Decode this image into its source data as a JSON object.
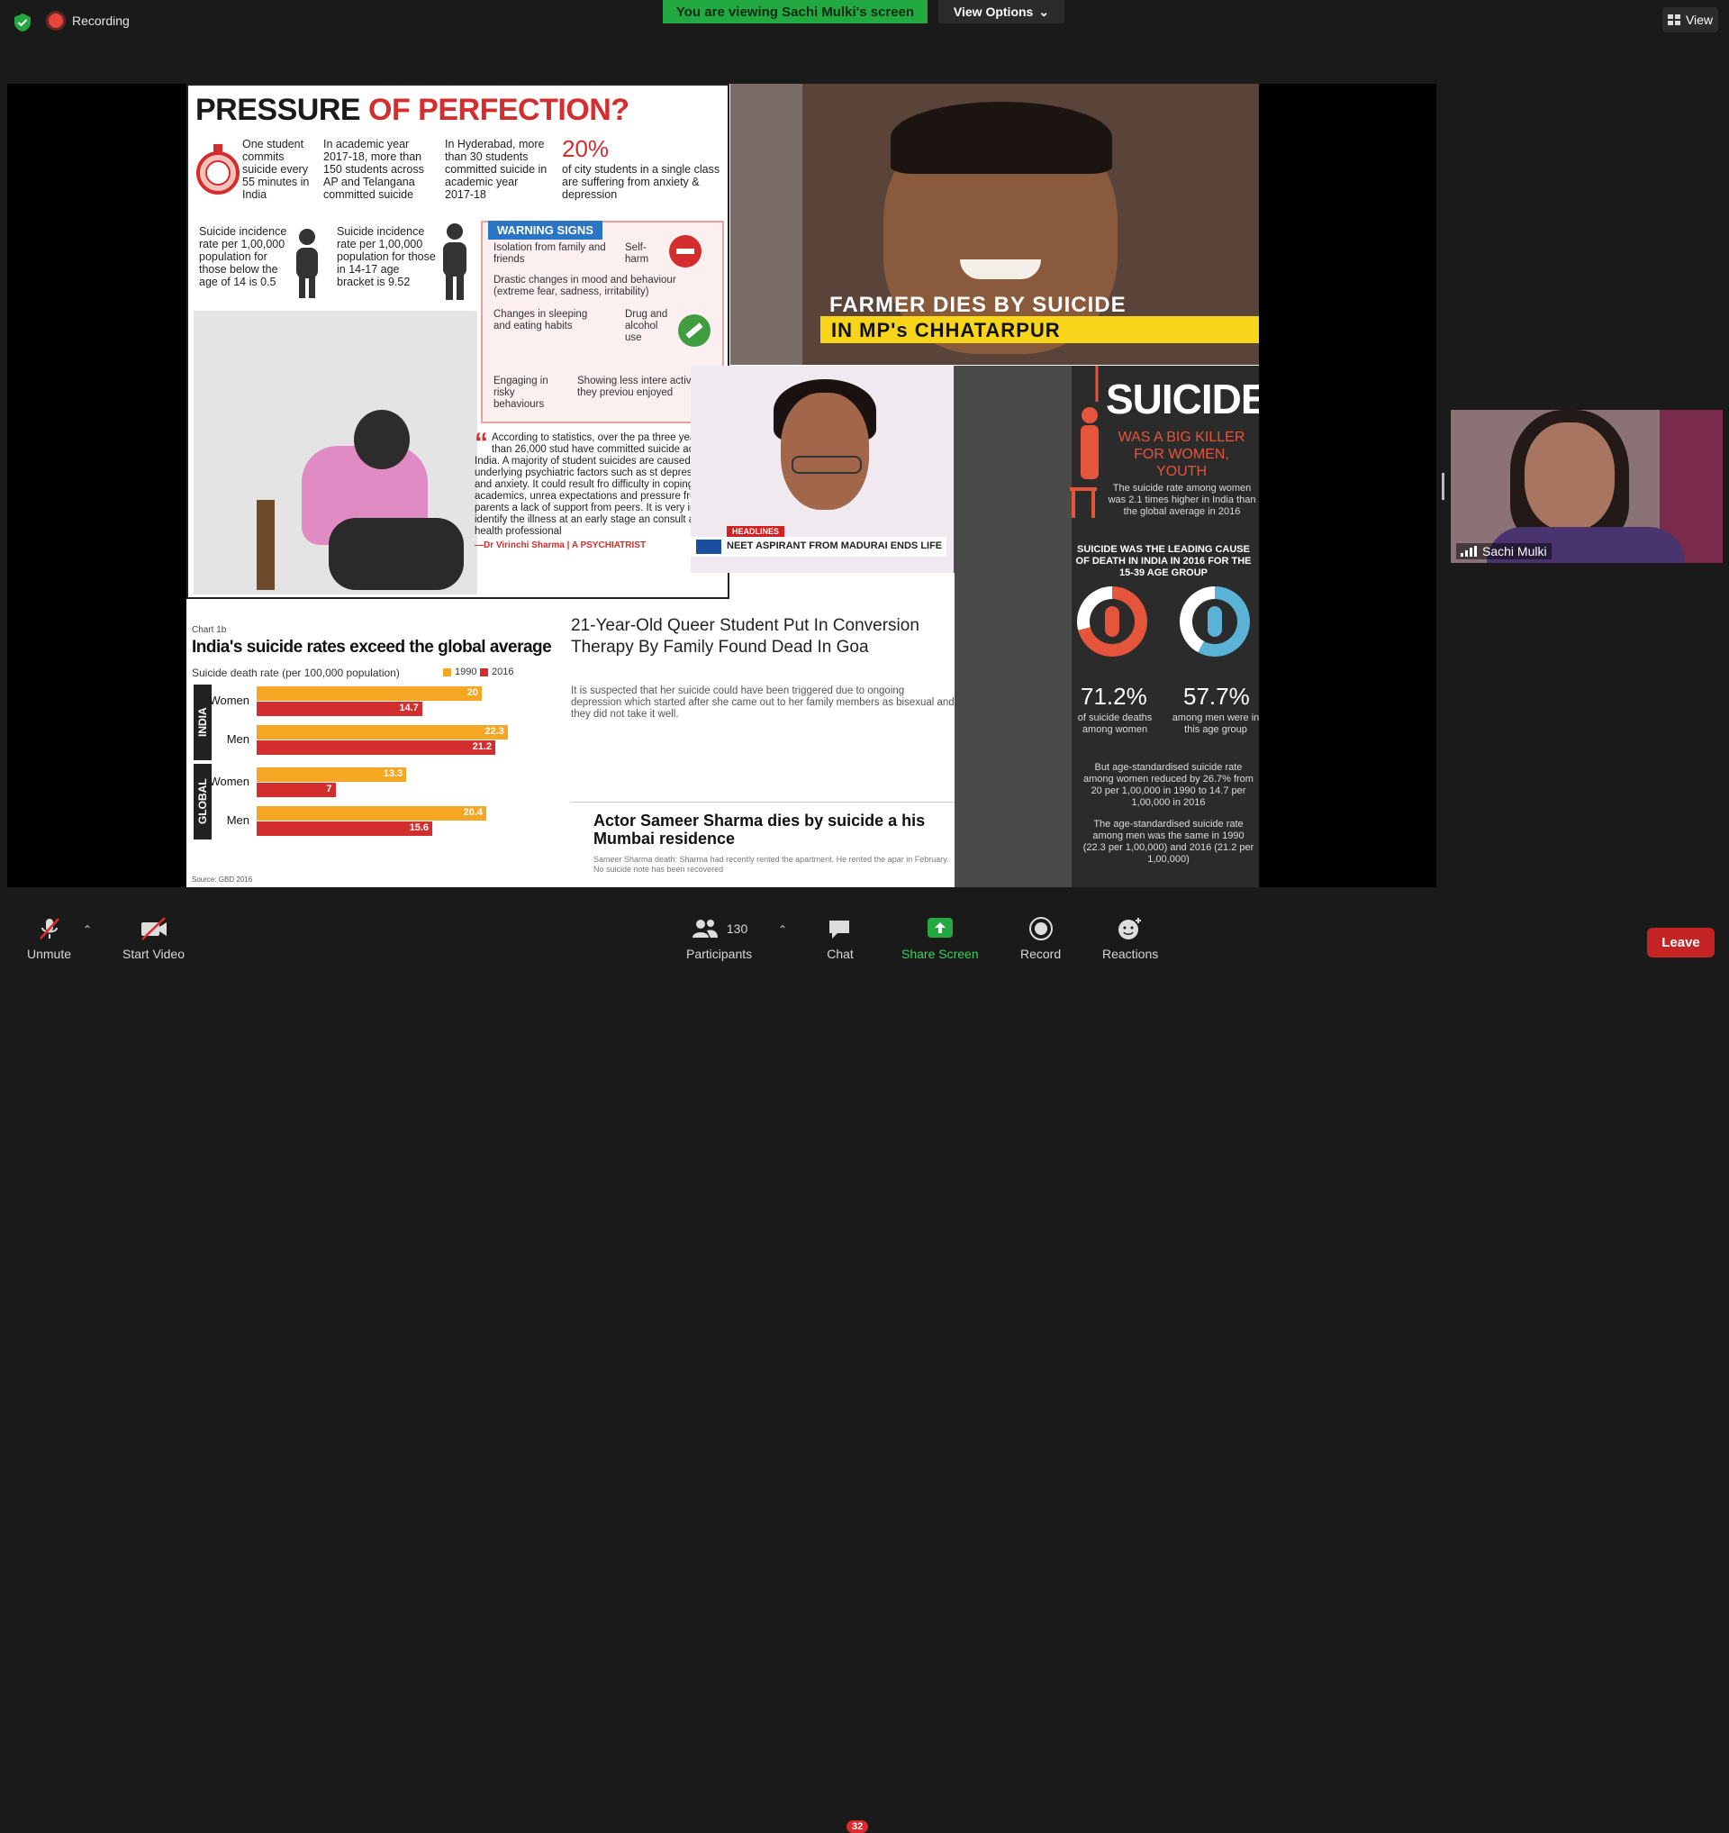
{
  "topbar": {
    "recording_label": "Recording",
    "viewing_banner": "You are viewing Sachi Mulki's screen",
    "view_options_label": "View Options",
    "view_label": "View"
  },
  "slide": {
    "pressure": {
      "title_a": "PRESSURE",
      "title_b": "OF PERFECTION?",
      "stat1": "One student commits suicide every 55 minutes in India",
      "stat2": "In academic year 2017-18, more than 150 students across AP and Telangana committed suicide",
      "stat3": "In Hyderabad, more than 30 students committed suicide in academic year 2017-18",
      "stat4_pct": "20%",
      "stat4": "of city students in a single class are suffering from anxiety & depression",
      "stat5": "Suicide incidence rate per 1,00,000 population for those below the age of 14 is 0.5",
      "stat6": "Suicide incidence rate per 1,00,000 population for those in 14-17 age bracket is 9.52",
      "warning_header": "WARNING SIGNS",
      "warn1": "Isolation from family and friends",
      "warn2": "Self-harm",
      "warn3": "Drastic changes in mood and behaviour (extreme fear, sadness, irritability)",
      "warn4": "Changes in sleeping and eating habits",
      "warn5": "Drug and alcohol use",
      "warn6": "Engaging in risky behaviours",
      "warn7": "Showing less intere activities they previou enjoyed",
      "quote": "According to statistics, over the pa three years more than 26,000 stud have committed suicide across India. A majority of student suicides are caused b underlying psychiatric factors such as st depression and anxiety. It could result fro difficulty in coping with academics, unrea expectations and pressure from parents a lack of support from peers. It is very impo to identify the illness at an early stage an consult a mental health professional",
      "quote_author": "—Dr Virinchi Sharma | A PSYCHIATRIST"
    },
    "farmer": {
      "caption1": "FARMER DIES BY SUICIDE",
      "caption2": "IN MP's CHHATARPUR"
    },
    "neet": {
      "tag": "HEADLINES",
      "caption": "NEET ASPIRANT FROM MADURAI ENDS LIFE"
    },
    "suicide_info": {
      "title": "SUICIDE",
      "subtitle": "WAS A BIG KILLER FOR WOMEN, YOUTH",
      "text1": "The suicide rate among women was 2.1 times higher in India than the global average in 2016",
      "heading2": "SUICIDE WAS THE LEADING CAUSE OF DEATH IN INDIA IN 2016 FOR THE 15-39 AGE GROUP",
      "pct_women": "71.2%",
      "pct_women_label": "of suicide deaths among women",
      "pct_men": "57.7%",
      "pct_men_label": "among men were in this age group",
      "text3": "But age-standardised suicide rate among women reduced by 26.7% from 20 per 1,00,000 in 1990 to 14.7 per 1,00,000 in 2016",
      "text4": "The age-standardised suicide rate among men was the same in 1990 (22.3 per 1,00,000) and 2016 (21.2 per 1,00,000)",
      "accent_color": "#e5553b"
    },
    "chart": {
      "tag": "Chart 1b",
      "title": "India's suicide rates exceed the global average",
      "subtitle": "Suicide death rate (per 100,000 population)",
      "legend_1990": "1990",
      "legend_2016": "2016",
      "group_india": "INDIA",
      "group_global": "GLOBAL",
      "row_women": "Women",
      "row_men": "Men",
      "source": "Source: GBD 2016"
    },
    "article1": {
      "headline": "21-Year-Old Queer Student Put In Conversion Therapy By Family Found Dead In Goa",
      "body": "It is suspected that her suicide could have been triggered due to ongoing depression which started after she came out to her family members as bisexual and they did not take it well."
    },
    "article2": {
      "headline": "Actor Sameer Sharma dies by suicide a his Mumbai residence",
      "body": "Sameer Sharma death: Sharma had recently rented the apartment. He rented the apar in February. No suicide note has been recovered"
    }
  },
  "chart_data": {
    "type": "bar",
    "title": "India's suicide rates exceed the global average",
    "ylabel": "Suicide death rate (per 100,000 population)",
    "categories": [
      "India Women",
      "India Men",
      "Global Women",
      "Global Men"
    ],
    "series": [
      {
        "name": "1990",
        "values": [
          20,
          22.3,
          13.3,
          20.4
        ],
        "color": "#f5a623"
      },
      {
        "name": "2016",
        "values": [
          14.7,
          21.2,
          7,
          15.6
        ],
        "color": "#d42d2d"
      }
    ],
    "xlim": [
      0,
      25
    ]
  },
  "participant": {
    "name": "Sachi Mulki"
  },
  "toolbar": {
    "unmute": "Unmute",
    "start_video": "Start Video",
    "participants": "Participants",
    "participants_count": "130",
    "chat": "Chat",
    "chat_badge": "32",
    "share_screen": "Share Screen",
    "record": "Record",
    "reactions": "Reactions",
    "leave": "Leave"
  },
  "colors": {
    "accent_green": "#23a942",
    "leave_red": "#c42424",
    "share_green": "#23a942"
  }
}
